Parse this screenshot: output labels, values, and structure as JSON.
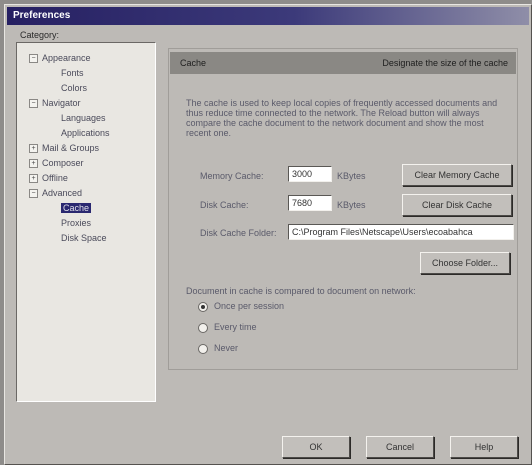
{
  "window": {
    "title": "Preferences"
  },
  "category": {
    "label": "Category:",
    "items": [
      {
        "label": "Appearance",
        "expander": "−",
        "level": 0
      },
      {
        "label": "Fonts",
        "expander": "",
        "level": 1
      },
      {
        "label": "Colors",
        "expander": "",
        "level": 1
      },
      {
        "label": "Navigator",
        "expander": "−",
        "level": 0
      },
      {
        "label": "Languages",
        "expander": "",
        "level": 1
      },
      {
        "label": "Applications",
        "expander": "",
        "level": 1
      },
      {
        "label": "Mail & Groups",
        "expander": "+",
        "level": 0
      },
      {
        "label": "Composer",
        "expander": "+",
        "level": 0
      },
      {
        "label": "Offline",
        "expander": "+",
        "level": 0
      },
      {
        "label": "Advanced",
        "expander": "−",
        "level": 0
      },
      {
        "label": "Cache",
        "expander": "",
        "level": 1,
        "selected": true
      },
      {
        "label": "Proxies",
        "expander": "",
        "level": 1
      },
      {
        "label": "Disk Space",
        "expander": "",
        "level": 1
      }
    ]
  },
  "panel": {
    "title": "Cache",
    "description": "Designate the size of the cache",
    "body_text": "The cache is used to keep local copies of frequently accessed documents and thus reduce time connected to the network. The Reload button will always compare the cache document to the network document and show the most recent one.",
    "memory_cache": {
      "label": "Memory Cache:",
      "value": "3000",
      "unit": "KBytes",
      "button": "Clear Memory Cache"
    },
    "disk_cache": {
      "label": "Disk Cache:",
      "value": "7680",
      "unit": "KBytes",
      "button": "Clear Disk Cache"
    },
    "disk_cache_folder": {
      "label": "Disk Cache Folder:",
      "value": "C:\\Program Files\\Netscape\\Users\\ecoabahca",
      "button": "Choose Folder..."
    },
    "compare": {
      "label": "Document in cache is compared to document on network:",
      "options": [
        {
          "label": "Once per session",
          "selected": true
        },
        {
          "label": "Every time",
          "selected": false
        },
        {
          "label": "Never",
          "selected": false
        }
      ]
    }
  },
  "buttons": {
    "ok": "OK",
    "cancel": "Cancel",
    "help": "Help"
  }
}
